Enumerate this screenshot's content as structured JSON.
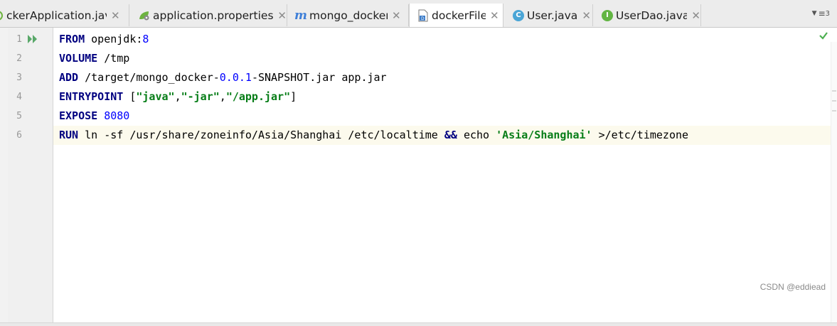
{
  "tabs": [
    {
      "label": "ckerApplication.java",
      "icon": "spring-boot-icon",
      "active": false
    },
    {
      "label": "application.properties",
      "icon": "spring-config-icon",
      "active": false
    },
    {
      "label": "mongo_docker",
      "icon": "maven-module-icon",
      "active": false
    },
    {
      "label": "dockerFile",
      "icon": "dockerfile-icon",
      "active": true
    },
    {
      "label": "User.java",
      "icon": "class-icon",
      "badge": "C",
      "active": false
    },
    {
      "label": "UserDao.java",
      "icon": "interface-icon",
      "badge": "I",
      "active": false
    }
  ],
  "tab_overflow": {
    "icon": "tab-list-icon",
    "count": "3"
  },
  "editor": {
    "line_numbers": [
      "1",
      "2",
      "3",
      "4",
      "5",
      "6"
    ],
    "current_line": 6,
    "lines": [
      [
        {
          "t": "FROM",
          "c": "kw"
        },
        {
          "t": " openjdk:",
          "c": "plain"
        },
        {
          "t": "8",
          "c": "num"
        }
      ],
      [
        {
          "t": "VOLUME",
          "c": "kw"
        },
        {
          "t": " /tmp",
          "c": "plain"
        }
      ],
      [
        {
          "t": "ADD",
          "c": "kw"
        },
        {
          "t": " /target/mongo_docker-",
          "c": "plain"
        },
        {
          "t": "0.0.1",
          "c": "num"
        },
        {
          "t": "-SNAPSHOT.jar app.jar",
          "c": "plain"
        }
      ],
      [
        {
          "t": "ENTRYPOINT",
          "c": "kw"
        },
        {
          "t": " [",
          "c": "plain"
        },
        {
          "t": "\"java\"",
          "c": "str"
        },
        {
          "t": ",",
          "c": "plain"
        },
        {
          "t": "\"-jar\"",
          "c": "str"
        },
        {
          "t": ",",
          "c": "plain"
        },
        {
          "t": "\"/app.jar\"",
          "c": "str"
        },
        {
          "t": "]",
          "c": "plain"
        }
      ],
      [
        {
          "t": "EXPOSE",
          "c": "kw"
        },
        {
          "t": " ",
          "c": "plain"
        },
        {
          "t": "8080",
          "c": "num"
        }
      ],
      [
        {
          "t": "RUN",
          "c": "kw"
        },
        {
          "t": " ln -sf /usr/share/zoneinfo/Asia/Shanghai /etc/localtime ",
          "c": "plain"
        },
        {
          "t": "&&",
          "c": "kw"
        },
        {
          "t": " echo ",
          "c": "plain"
        },
        {
          "t": "'Asia/Shanghai'",
          "c": "str"
        },
        {
          "t": " >/etc/timezone",
          "c": "plain"
        }
      ]
    ]
  },
  "colors": {
    "keyword": "#000080",
    "number": "#0000ff",
    "string": "#067d17",
    "current_line_bg": "#fcfaed",
    "ok_check": "#4caf50"
  },
  "watermark": "CSDN @eddiead"
}
